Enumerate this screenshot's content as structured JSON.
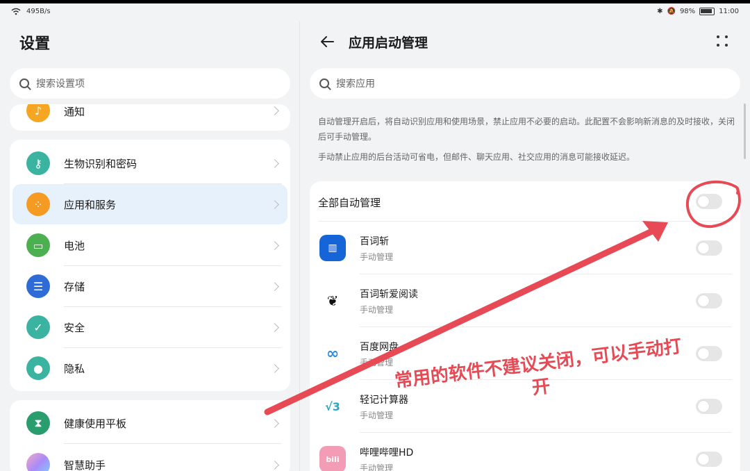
{
  "status": {
    "speed": "495B/s",
    "battery": "98%",
    "time": "11:00"
  },
  "left": {
    "title": "设置",
    "search_placeholder": "搜索设置项",
    "items_top": [
      {
        "label": "通知",
        "icon": "bell-icon",
        "color": "#f5a623"
      }
    ],
    "items_main": [
      {
        "label": "生物识别和密码",
        "icon": "key-icon",
        "color": "#3bb3a1"
      },
      {
        "label": "应用和服务",
        "icon": "apps-icon",
        "color": "#f59b23"
      },
      {
        "label": "电池",
        "icon": "battery-icon",
        "color": "#4caf50"
      },
      {
        "label": "存储",
        "icon": "storage-icon",
        "color": "#2f6bd7"
      },
      {
        "label": "安全",
        "icon": "shield-icon",
        "color": "#3bb3a1"
      },
      {
        "label": "隐私",
        "icon": "privacy-icon",
        "color": "#3bb3a1"
      }
    ],
    "items_bottom": [
      {
        "label": "健康使用平板",
        "icon": "hourglass-icon",
        "color": "#2a9d6f"
      },
      {
        "label": "智慧助手",
        "icon": "assistant-icon",
        "color": "#a78bfa"
      }
    ]
  },
  "right": {
    "title": "应用启动管理",
    "search_placeholder": "搜索应用",
    "desc1": "自动管理开启后，将自动识别应用和使用场景，禁止应用不必要的启动。此配置不会影响新消息的及时接收，关闭后可手动管理。",
    "desc2": "手动禁止应用的后台活动可省电，但邮件、聊天应用、社交应用的消息可能接收延迟。",
    "all_label": "全部自动管理",
    "apps": [
      {
        "name": "百词斩",
        "sub": "手动管理",
        "icon_text": "▥",
        "bg": "#1565d8",
        "fg": "#ffffff"
      },
      {
        "name": "百词斩爱阅读",
        "sub": "手动管理",
        "icon_text": "❦",
        "bg": "#ffffff",
        "fg": "#111111"
      },
      {
        "name": "百度网盘",
        "sub": "手动管理",
        "icon_text": "∞",
        "bg": "#ffffff",
        "fg": "#2e8be0"
      },
      {
        "name": "轻记计算器",
        "sub": "手动管理",
        "icon_text": "√3",
        "bg": "#ffffff",
        "fg": "#2aa7c4"
      },
      {
        "name": "哔哩哔哩HD",
        "sub": "手动管理",
        "icon_text": "bili",
        "bg": "#f29cb6",
        "fg": "#ffffff"
      }
    ]
  },
  "annotation": {
    "text_line1": "常用的软件不建议关闭，可以手动打",
    "text_line2": "开",
    "color": "#e84a55"
  }
}
